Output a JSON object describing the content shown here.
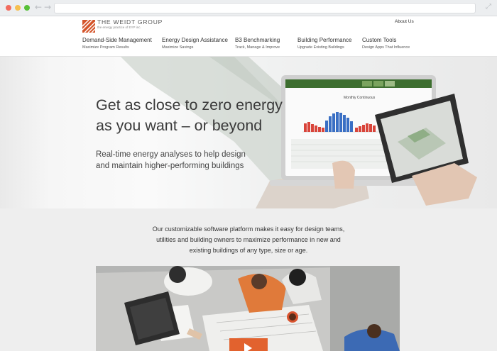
{
  "browser": {
    "back_icon": "back-arrow-icon",
    "forward_icon": "forward-arrow-icon",
    "expand_icon": "expand-icon",
    "back_glyph": "←",
    "forward_glyph": "→",
    "expand_glyph": "⤢"
  },
  "header": {
    "logo_name": "THE WEIDT GROUP",
    "logo_tagline": "the energy practice of EYP inc.",
    "about_link": "About Us",
    "brand_color": "#d4552b"
  },
  "nav": [
    {
      "title": "Demand-Side Management",
      "subtitle": "Maximize Program Results"
    },
    {
      "title": "Energy Design Assistance",
      "subtitle": "Maximize Savings"
    },
    {
      "title": "B3 Benchmarking",
      "subtitle": "Track, Manage & Improve"
    },
    {
      "title": "Building Performance",
      "subtitle": "Upgrade Existing Buildings"
    },
    {
      "title": "Custom Tools",
      "subtitle": "Design Apps That Influence"
    }
  ],
  "hero": {
    "headline_line1": "Get as close to zero energy",
    "headline_line2": "as you want – or beyond",
    "sub_line1": "Real-time energy analyses to help design",
    "sub_line2": "and maintain higher-performing buildings",
    "laptop_chart_title": "Monthly Continuous"
  },
  "intro": {
    "line1": "Our customizable software platform makes it easy for design teams,",
    "line2": "utilities and building owners to maximize performance in new and",
    "line3": "existing buildings of any type, size or age."
  },
  "video": {
    "play_icon": "play-icon"
  }
}
